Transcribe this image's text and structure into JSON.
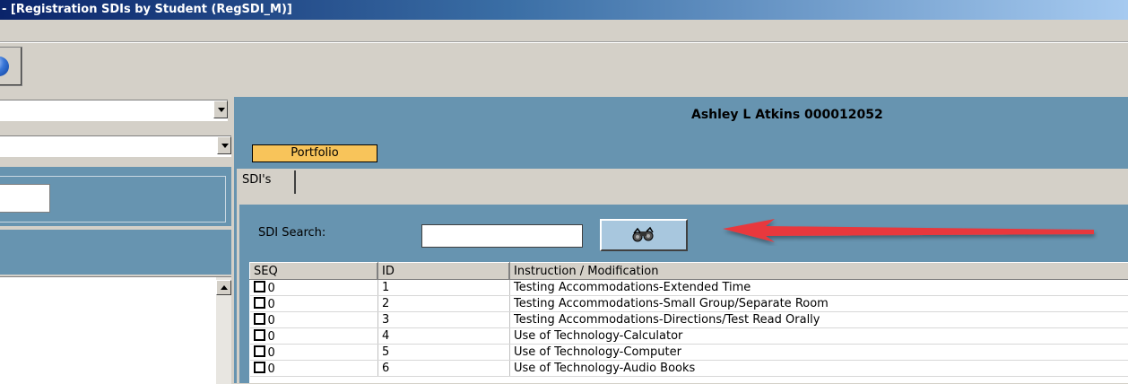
{
  "window": {
    "title": "- [Registration SDIs by Student (RegSDI_M)]"
  },
  "header": {
    "student_name": "Ashley L  Atkins  000012052"
  },
  "buttons": {
    "portfolio": "Portfolio"
  },
  "tabs": [
    {
      "label": "SDI's"
    }
  ],
  "search": {
    "label": "SDI Search:",
    "value": ""
  },
  "grid": {
    "columns": [
      "SEQ",
      "ID",
      "Instruction / Modification"
    ],
    "rows": [
      {
        "seq": "0",
        "id": "1",
        "instruction": "Testing Accommodations-Extended Time"
      },
      {
        "seq": "0",
        "id": "2",
        "instruction": "Testing Accommodations-Small Group/Separate Room"
      },
      {
        "seq": "0",
        "id": "3",
        "instruction": "Testing Accommodations-Directions/Test Read Orally"
      },
      {
        "seq": "0",
        "id": "4",
        "instruction": "Use of Technology-Calculator"
      },
      {
        "seq": "0",
        "id": "5",
        "instruction": "Use of Technology-Computer"
      },
      {
        "seq": "0",
        "id": "6",
        "instruction": "Use of Technology-Audio Books"
      }
    ]
  },
  "icons": {
    "find_button": "binoculars-icon",
    "toolbar_button": "blue-orb-icon"
  },
  "colors": {
    "panel_blue": "#6794b0",
    "portfolio_button": "#f8c45a",
    "annotation_arrow": "#e8383d"
  }
}
